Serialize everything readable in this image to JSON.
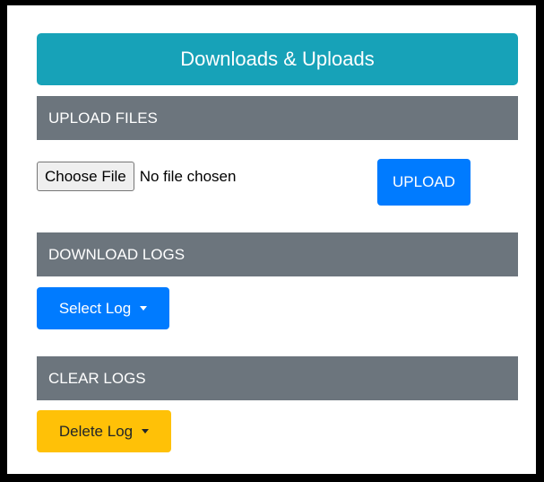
{
  "panel": {
    "title": "Downloads & Uploads"
  },
  "upload_section": {
    "header": "UPLOAD FILES",
    "choose_file_label": "Choose File",
    "file_status": "No file chosen",
    "upload_button": "UPLOAD"
  },
  "download_section": {
    "header": "DOWNLOAD LOGS",
    "select_log_button": "Select Log"
  },
  "clear_section": {
    "header": "CLEAR LOGS",
    "delete_log_button": "Delete Log"
  },
  "colors": {
    "title_bg": "#17a2b8",
    "section_header_bg": "#6c757d",
    "primary": "#007bff",
    "warning": "#ffc107"
  },
  "icons": {
    "dropdown": "caret-down-icon"
  }
}
